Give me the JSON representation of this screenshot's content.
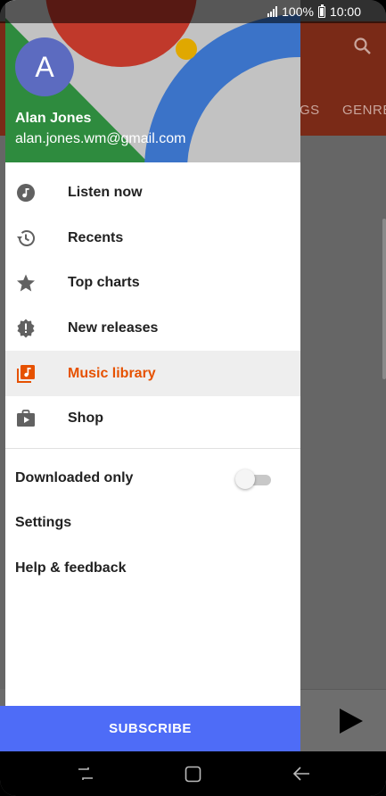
{
  "status_bar": {
    "battery_text": "100%",
    "time": "10:00"
  },
  "background_app": {
    "tabs": [
      "GS",
      "GENRE"
    ]
  },
  "drawer": {
    "account": {
      "avatar_letter": "A",
      "name": "Alan Jones",
      "email": "alan.jones.wm@gmail.com"
    },
    "nav_items": [
      {
        "label": "Listen now",
        "icon": "listen-now-icon"
      },
      {
        "label": "Recents",
        "icon": "recents-icon"
      },
      {
        "label": "Top charts",
        "icon": "star-icon"
      },
      {
        "label": "New releases",
        "icon": "new-releases-icon"
      },
      {
        "label": "Music library",
        "icon": "music-library-icon",
        "active": true
      },
      {
        "label": "Shop",
        "icon": "shop-icon"
      }
    ],
    "settings": {
      "downloaded_only": {
        "label": "Downloaded only",
        "enabled": false
      },
      "settings_label": "Settings",
      "help_label": "Help & feedback"
    },
    "subscribe_label": "SUBSCRIBE"
  },
  "colors": {
    "accent": "#e65100",
    "subscribe": "#4e6cf7",
    "avatar": "#5c6bc0"
  }
}
